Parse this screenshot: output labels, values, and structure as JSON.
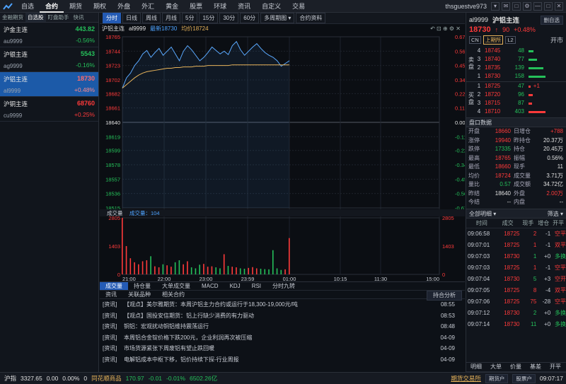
{
  "topbar": {
    "menu": [
      "自选",
      "合约",
      "期货",
      "期权",
      "外盘",
      "外汇",
      "黄金",
      "股票",
      "环球",
      "资讯",
      "自定义",
      "交易"
    ],
    "active": "合约",
    "user": "thsguestve973",
    "btns": [
      "▾",
      "✉",
      "□",
      "⚙",
      "—",
      "□",
      "✕"
    ]
  },
  "left": {
    "tabs": [
      "金融期货",
      "自选股",
      "盯盘助手",
      "快讯"
    ],
    "active_tab": "自选股",
    "rows": [
      {
        "name": "沪金主连",
        "code": "au9999",
        "price": "443.82",
        "chg": "-0.56%",
        "dir": "dn"
      },
      {
        "name": "沪银主连",
        "code": "ag9999",
        "price": "5543",
        "chg": "-0.16%",
        "dir": "dn"
      },
      {
        "name": "沪铝主连",
        "code": "al9999",
        "price": "18730",
        "chg": "+0.48%",
        "dir": "up",
        "selected": true
      },
      {
        "name": "沪铜主连",
        "code": "cu9999",
        "price": "68760",
        "chg": "+0.25%",
        "dir": "up"
      }
    ]
  },
  "periods": [
    "分时",
    "日线",
    "周线",
    "月线",
    "5分",
    "15分",
    "30分",
    "60分",
    "多周期图 ▾",
    "合约资料"
  ],
  "period_active": "分时",
  "info": {
    "name": "沪铝主连",
    "code": "al9999",
    "latest_label": "最新",
    "latest": "18730",
    "avg_label": "均价",
    "avg": "18724",
    "icons": "↶ ⊡ ⊕ ⚙ ✕"
  },
  "chart_data": {
    "type": "line",
    "y_ticks": [
      "18765",
      "18744",
      "18723",
      "18702",
      "18682",
      "18661",
      "18640",
      "18619",
      "18599",
      "18578",
      "18557",
      "18536",
      "18515"
    ],
    "pct_ticks": [
      "0.67%",
      "0.56%",
      "0.45%",
      "0.34%",
      "0.22%",
      "0.11%",
      "0.00%",
      "-0.11%",
      "-0.22%",
      "-0.34%",
      "-0.45%",
      "-0.56%",
      "-0.67%"
    ],
    "ylim": [
      18515,
      18765
    ],
    "prev_close": 18640,
    "x_ticks": [
      "21:00",
      "22:00",
      "23:00",
      "23:59",
      "01:00",
      "10:15",
      "11:30",
      "15:00"
    ],
    "vol_ticks_left": [
      "2805",
      "1403",
      "0"
    ],
    "vol_ticks_right": [
      "2805",
      "1403",
      "0"
    ],
    "vol_label": "成交量",
    "vol_val_label": "成交量：104",
    "price_series": [
      18690,
      18705,
      18712,
      18723,
      18730,
      18740,
      18745,
      18735,
      18742,
      18748,
      18738,
      18744,
      18750,
      18740,
      18730,
      18744,
      18752,
      18746,
      18738,
      18730,
      18735,
      18742,
      18750,
      18745,
      18740,
      18744,
      18739,
      18752,
      18758,
      18746,
      18738,
      18744,
      18750,
      18755,
      18748,
      18742,
      18738,
      18735,
      18730,
      18722,
      18726,
      18730
    ],
    "avg_series": [
      18690,
      18695,
      18700,
      18705,
      18709,
      18712,
      18714,
      18715,
      18716,
      18717,
      18718,
      18719,
      18719,
      18720,
      18720,
      18721,
      18721,
      18721,
      18722,
      18722,
      18722,
      18723,
      18723,
      18723,
      18723,
      18723,
      18723,
      18724,
      18724,
      18724,
      18724,
      18724,
      18724,
      18724,
      18724,
      18724,
      18724,
      18724,
      18724,
      18724,
      18724,
      18724
    ],
    "volume": [
      2805,
      1403,
      800,
      600,
      500,
      650,
      700,
      900,
      400,
      350,
      500,
      450,
      380,
      600,
      700,
      500,
      650,
      350,
      300,
      480,
      520,
      380,
      400,
      350,
      300,
      1000,
      420,
      380,
      350,
      300,
      280,
      320,
      360,
      300,
      280,
      260,
      250,
      1200,
      300,
      220,
      250,
      1800
    ]
  },
  "bottom_tabs": [
    "成交量",
    "持仓量",
    "大单成交量",
    "MACD",
    "KDJ",
    "RSI",
    "分时九转"
  ],
  "news_tabs": [
    "资讯",
    "关联品种",
    "相关合约"
  ],
  "news_btn": "持合分析",
  "news": [
    {
      "src": "[资讯]",
      "title": "【观点】美尔雅期货：本周沪铝主力合约或运行于18,300-19,000元/吨",
      "date": "08:55"
    },
    {
      "src": "[资讯]",
      "title": "【观点】国投安信期货：铝上行缺少消费的有力驱动",
      "date": "08:53"
    },
    {
      "src": "[资讯]",
      "title": "铜铝：宏观扰动铜铝维持震荡运行",
      "date": "08:48"
    },
    {
      "src": "[资讯]",
      "title": "本周铝合金锭价格下跌200元，企业利润再次被压缩",
      "date": "04-09"
    },
    {
      "src": "[资讯]",
      "title": "市场货源紧张下周废铝有望止跌回暖",
      "date": "04-09"
    },
    {
      "src": "[资讯]",
      "title": "电解铝成本中枢下移，铝价持续下探-行业周报",
      "date": "04-09"
    }
  ],
  "right": {
    "code": "al9999",
    "name": "沪铝主连",
    "btn": "删自选",
    "price": "18730",
    "change": "90",
    "pct": "+0.48%",
    "tags": [
      "CN",
      "上期所",
      "L2"
    ],
    "open_lbl": "开市",
    "sell_label": "卖盘",
    "buy_label": "买盘",
    "asks": [
      {
        "n": "4",
        "p": "18745",
        "v": "48"
      },
      {
        "n": "3",
        "p": "18740",
        "v": "77"
      },
      {
        "n": "2",
        "p": "18735",
        "v": "139"
      },
      {
        "n": "1",
        "p": "18730",
        "v": "158"
      }
    ],
    "bids": [
      {
        "n": "1",
        "p": "18725",
        "v": "47",
        "d": "+1"
      },
      {
        "n": "2",
        "p": "18720",
        "v": "96"
      },
      {
        "n": "3",
        "p": "18715",
        "v": "87"
      },
      {
        "n": "4",
        "p": "18710",
        "v": "403"
      }
    ],
    "panel_title": "盘口数据",
    "stats": [
      [
        "开盘",
        "18660",
        "日增仓",
        "+788"
      ],
      [
        "涨停",
        "19940",
        "昨持仓",
        "20.37万"
      ],
      [
        "跌停",
        "17335",
        "持仓",
        "20.45万"
      ],
      [
        "最高",
        "18765",
        "振幅",
        "0.56%"
      ],
      [
        "最低",
        "18660",
        "现手",
        "11"
      ],
      [
        "均价",
        "18724",
        "成交量",
        "3.71万"
      ],
      [
        "量比",
        "0.57",
        "成交额",
        "34.72亿"
      ],
      [
        "昨结",
        "18640",
        "外盘",
        "2.00万"
      ],
      [
        "今结",
        "--",
        "内盘",
        "--"
      ]
    ],
    "detail_title": "全部明细 ▾",
    "filter": "筛选 ▾",
    "detail_head": [
      "时间",
      "成交",
      "现手",
      "增仓",
      "开平"
    ],
    "details": [
      [
        "09:06:58",
        "18725",
        "2",
        "-1",
        "空平"
      ],
      [
        "09:07:01",
        "18725",
        "1",
        "-1",
        "双平"
      ],
      [
        "09:07:03",
        "18730",
        "1",
        "+0",
        "多换"
      ],
      [
        "09:07:03",
        "18725",
        "1",
        "-1",
        "空平"
      ],
      [
        "09:07:04",
        "18730",
        "5",
        "+3",
        "空开"
      ],
      [
        "09:07:05",
        "18725",
        "8",
        "-4",
        "双平"
      ],
      [
        "09:07:06",
        "18725",
        "75",
        "-28",
        "空平"
      ],
      [
        "09:07:12",
        "18730",
        "2",
        "+0",
        "多换"
      ],
      [
        "09:07:14",
        "18730",
        "11",
        "+0",
        "多换"
      ]
    ],
    "footer": [
      "明细",
      "大单",
      "价量",
      "基差",
      "开平"
    ]
  },
  "status": {
    "idx_name": "沪指",
    "idx": "3327.65",
    "idx_chg": "0.00",
    "idx_pct": "0.00%",
    "idx_v": "0",
    "n2": "同花顺商品",
    "v2": "170.97",
    "c2": "-0.01",
    "p2": "-0.01%",
    "a2": "6502.26亿",
    "b1": "期货交易所",
    "b2": "期货户",
    "b3": "股票户",
    "time": "09:07:17"
  }
}
